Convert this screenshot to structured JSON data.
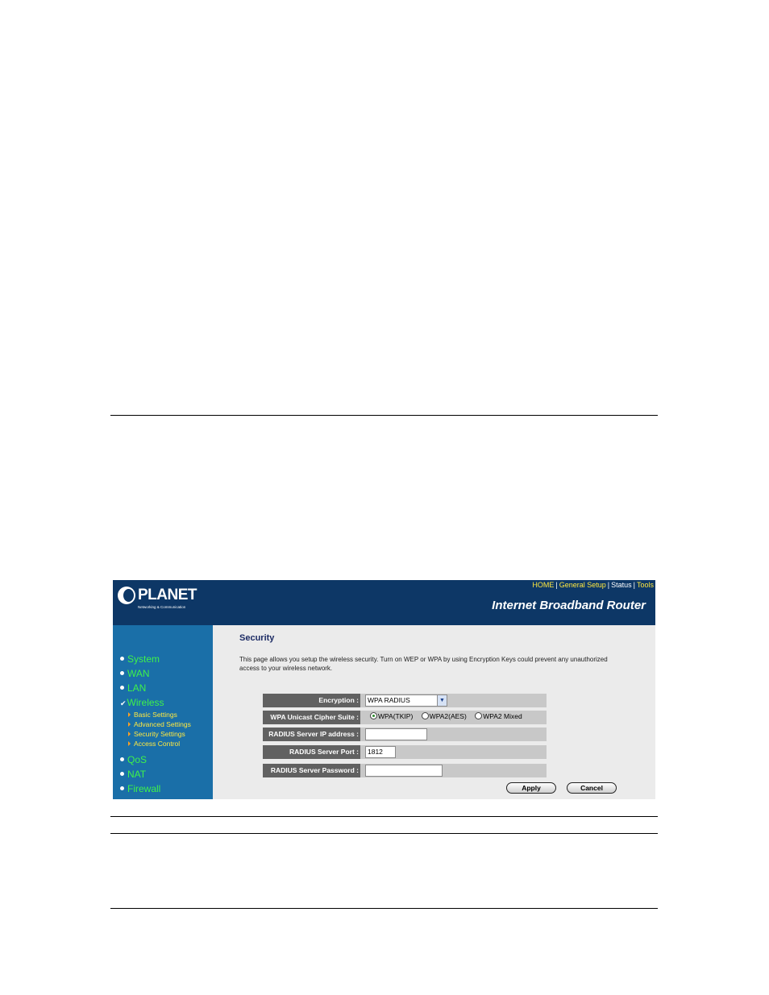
{
  "header": {
    "logo": "PLANET",
    "logo_tagline": "Networking & Communication",
    "links": [
      "HOME",
      "General Setup",
      "Status",
      "Tools"
    ],
    "product": "Internet Broadband Router"
  },
  "sidebar": {
    "items": [
      {
        "label": "System"
      },
      {
        "label": "WAN"
      },
      {
        "label": "LAN"
      },
      {
        "label": "Wireless",
        "active": true
      },
      {
        "label": "QoS"
      },
      {
        "label": "NAT"
      },
      {
        "label": "Firewall"
      }
    ],
    "wireless_sub": [
      {
        "label": "Basic Settings"
      },
      {
        "label": "Advanced Settings"
      },
      {
        "label": "Security Settings"
      },
      {
        "label": "Access Control"
      }
    ]
  },
  "main": {
    "title": "Security",
    "description": "This page allows you setup the wireless security. Turn on WEP or WPA by using Encryption Keys could prevent any unauthorized access to your wireless network.",
    "form": {
      "encryption_label": "Encryption :",
      "encryption_value": "WPA RADIUS",
      "cipher_label": "WPA Unicast Cipher Suite :",
      "cipher_options": [
        "WPA(TKIP)",
        "WPA2(AES)",
        "WPA2 Mixed"
      ],
      "cipher_selected": "WPA(TKIP)",
      "radius_ip_label": "RADIUS Server IP address :",
      "radius_ip_value": "",
      "radius_port_label": "RADIUS Server Port :",
      "radius_port_value": "1812",
      "radius_password_label": "RADIUS Server Password :",
      "radius_password_value": ""
    },
    "buttons": {
      "apply": "Apply",
      "cancel": "Cancel"
    }
  },
  "colors": {
    "header_bg": "#0d3766",
    "sidebar_bg": "#1a6fa8",
    "nav_text": "#3ff24a",
    "link_yellow": "#ffe840",
    "label_bg": "#616161",
    "content_bg": "#ebebeb"
  }
}
